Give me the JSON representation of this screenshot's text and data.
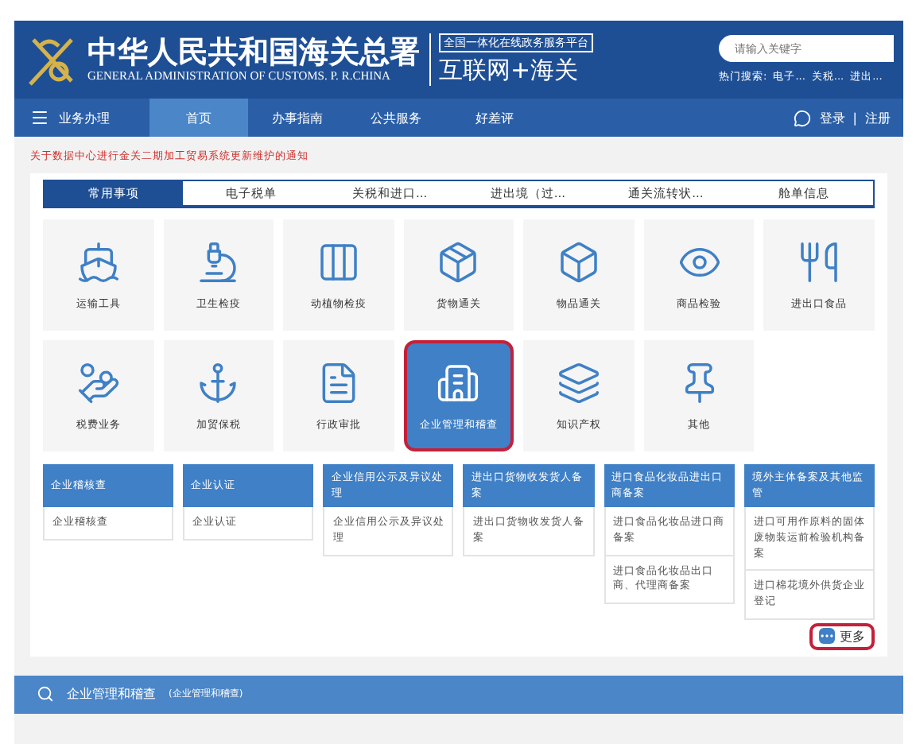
{
  "header": {
    "title": "中华人民共和国海关总署",
    "subtitle": "GENERAL ADMINISTRATION OF CUSTOMS. P. R.CHINA",
    "platform_tag": "全国一体化在线政务服务平台",
    "platform_name": "互联网+海关",
    "search": {
      "placeholder": "请输入关键字"
    },
    "hot_label": "热门搜索:",
    "hot_terms": [
      "电子...",
      "关税...",
      "进出..."
    ]
  },
  "nav": {
    "menu_label": "业务办理",
    "items": [
      {
        "label": "首页",
        "selected": true
      },
      {
        "label": "办事指南",
        "selected": false
      },
      {
        "label": "公共服务",
        "selected": false
      },
      {
        "label": "好差评",
        "selected": false
      }
    ],
    "login": "登录",
    "separator": "|",
    "register": "注册"
  },
  "notice": "关于数据中心进行金关二期加工贸易系统更新维护的通知",
  "tabs": [
    {
      "label": "常用事项",
      "selected": true
    },
    {
      "label": "电子税单",
      "selected": false
    },
    {
      "label": "关税和进口...",
      "selected": false
    },
    {
      "label": "进出境（过...",
      "selected": false
    },
    {
      "label": "通关流转状...",
      "selected": false
    },
    {
      "label": "舱单信息",
      "selected": false
    }
  ],
  "tiles": [
    {
      "label": "运输工具",
      "selected": false
    },
    {
      "label": "卫生检疫",
      "selected": false
    },
    {
      "label": "动植物检疫",
      "selected": false
    },
    {
      "label": "货物通关",
      "selected": false
    },
    {
      "label": "物品通关",
      "selected": false
    },
    {
      "label": "商品检验",
      "selected": false
    },
    {
      "label": "进出口食品",
      "selected": false
    },
    {
      "label": "税费业务",
      "selected": false
    },
    {
      "label": "加贸保税",
      "selected": false
    },
    {
      "label": "行政审批",
      "selected": false
    },
    {
      "label": "企业管理和稽查",
      "selected": true
    },
    {
      "label": "知识产权",
      "selected": false
    },
    {
      "label": "其他",
      "selected": false
    }
  ],
  "categories": [
    {
      "title": "企业稽核查",
      "items": [
        "企业稽核查"
      ]
    },
    {
      "title": "企业认证",
      "items": [
        "企业认证"
      ]
    },
    {
      "title": "企业信用公示及异议处理",
      "items": [
        "企业信用公示及异议处理"
      ]
    },
    {
      "title": "进出口货物收发货人备案",
      "items": [
        "进出口货物收发货人备案"
      ]
    },
    {
      "title": "进口食品化妆品进出口商备案",
      "items": [
        "进口食品化妆品进口商备案",
        "进口食品化妆品出口商、代理商备案"
      ]
    },
    {
      "title": "境外主体备案及其他监管",
      "items": [
        "进口可用作原料的固体废物装运前检验机构备案",
        "进口棉花境外供货企业登记"
      ]
    }
  ],
  "more_button": "更多",
  "section_bar": {
    "title": "企业管理和稽查",
    "subtitle": "(企业管理和稽查)"
  }
}
